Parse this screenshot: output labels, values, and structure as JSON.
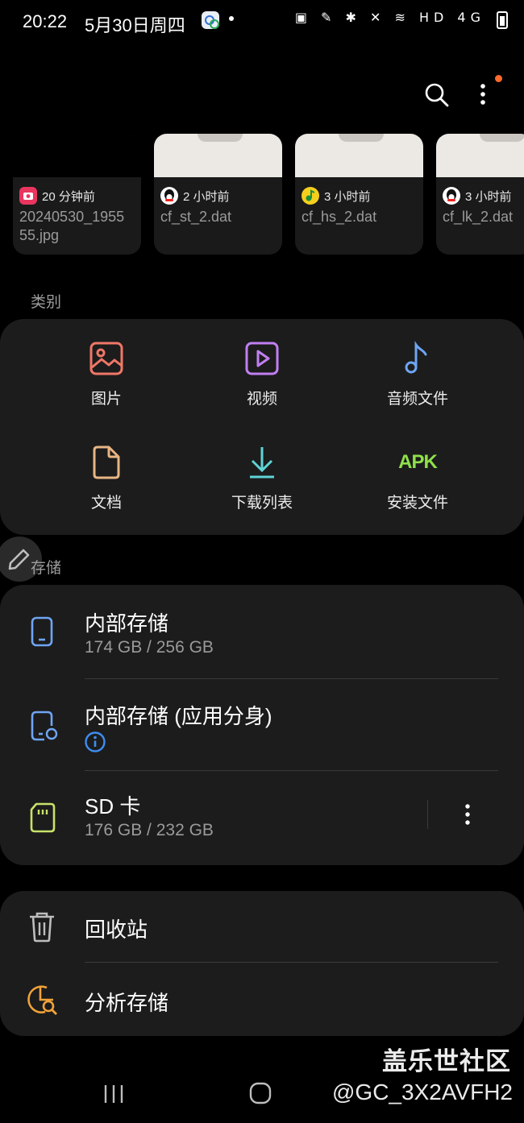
{
  "status_bar": {
    "time": "20:22",
    "date": "5月30日周四",
    "right_icons": "▣ ✎ ✱ ✕ ≋ HD 4G"
  },
  "toolbar": {
    "search_icon": "search-icon",
    "more_icon": "more-vertical-icon",
    "notification_color": "#ff6a2b"
  },
  "recent_files": [
    {
      "time": "20 分钟前",
      "name": "20240530_1955\n55.jpg",
      "app_icon": "camera-icon",
      "icon_color": "#e8365f"
    },
    {
      "time": "2 小时前",
      "name": "cf_st_2.dat",
      "app_icon": "qq-penguin-icon",
      "icon_color": "#ffffff"
    },
    {
      "time": "3 小时前",
      "name": "cf_hs_2.dat",
      "app_icon": "qq-music-icon",
      "icon_color": "#f5cf1d"
    },
    {
      "time": "3 小时前",
      "name": "cf_lk_2.dat",
      "app_icon": "qq-penguin-icon",
      "icon_color": "#ffffff"
    }
  ],
  "categories_label": "类别",
  "categories": [
    {
      "label": "图片",
      "icon": "image-icon",
      "color": "#f07767"
    },
    {
      "label": "视频",
      "icon": "video-icon",
      "color": "#c17ff2"
    },
    {
      "label": "音频文件",
      "icon": "music-note-icon",
      "color": "#6fa5f4"
    },
    {
      "label": "文档",
      "icon": "document-icon",
      "color": "#e8b583"
    },
    {
      "label": "下载列表",
      "icon": "download-icon",
      "color": "#5fd3d6"
    },
    {
      "label": "安装文件",
      "icon": "apk-icon",
      "icon_text": "APK",
      "color": "#8fe04a"
    }
  ],
  "storage_label": "存储",
  "storage": [
    {
      "title": "内部存储",
      "sub": "174 GB / 256 GB",
      "icon": "phone-icon",
      "color": "#6fa5f4"
    },
    {
      "title": "内部存储 (应用分身)",
      "sub": "",
      "icon": "dual-app-phone-icon",
      "color": "#6fa5f4",
      "info_icon": "info-icon"
    },
    {
      "title": "SD 卡",
      "sub": "176 GB / 232 GB",
      "icon": "sd-card-icon",
      "color": "#c8e26a"
    }
  ],
  "tools": [
    {
      "title": "回收站",
      "icon": "trash-icon",
      "color": "#bdbdbd"
    },
    {
      "title": "分析存储",
      "icon": "analyze-storage-icon",
      "color": "#f3a33a"
    }
  ],
  "watermark": {
    "site": "盖乐世社区",
    "user": "@GC_3X2AVFH2"
  },
  "nav": {
    "recent": "recents-icon",
    "home": "home-icon",
    "back": "back-icon"
  }
}
